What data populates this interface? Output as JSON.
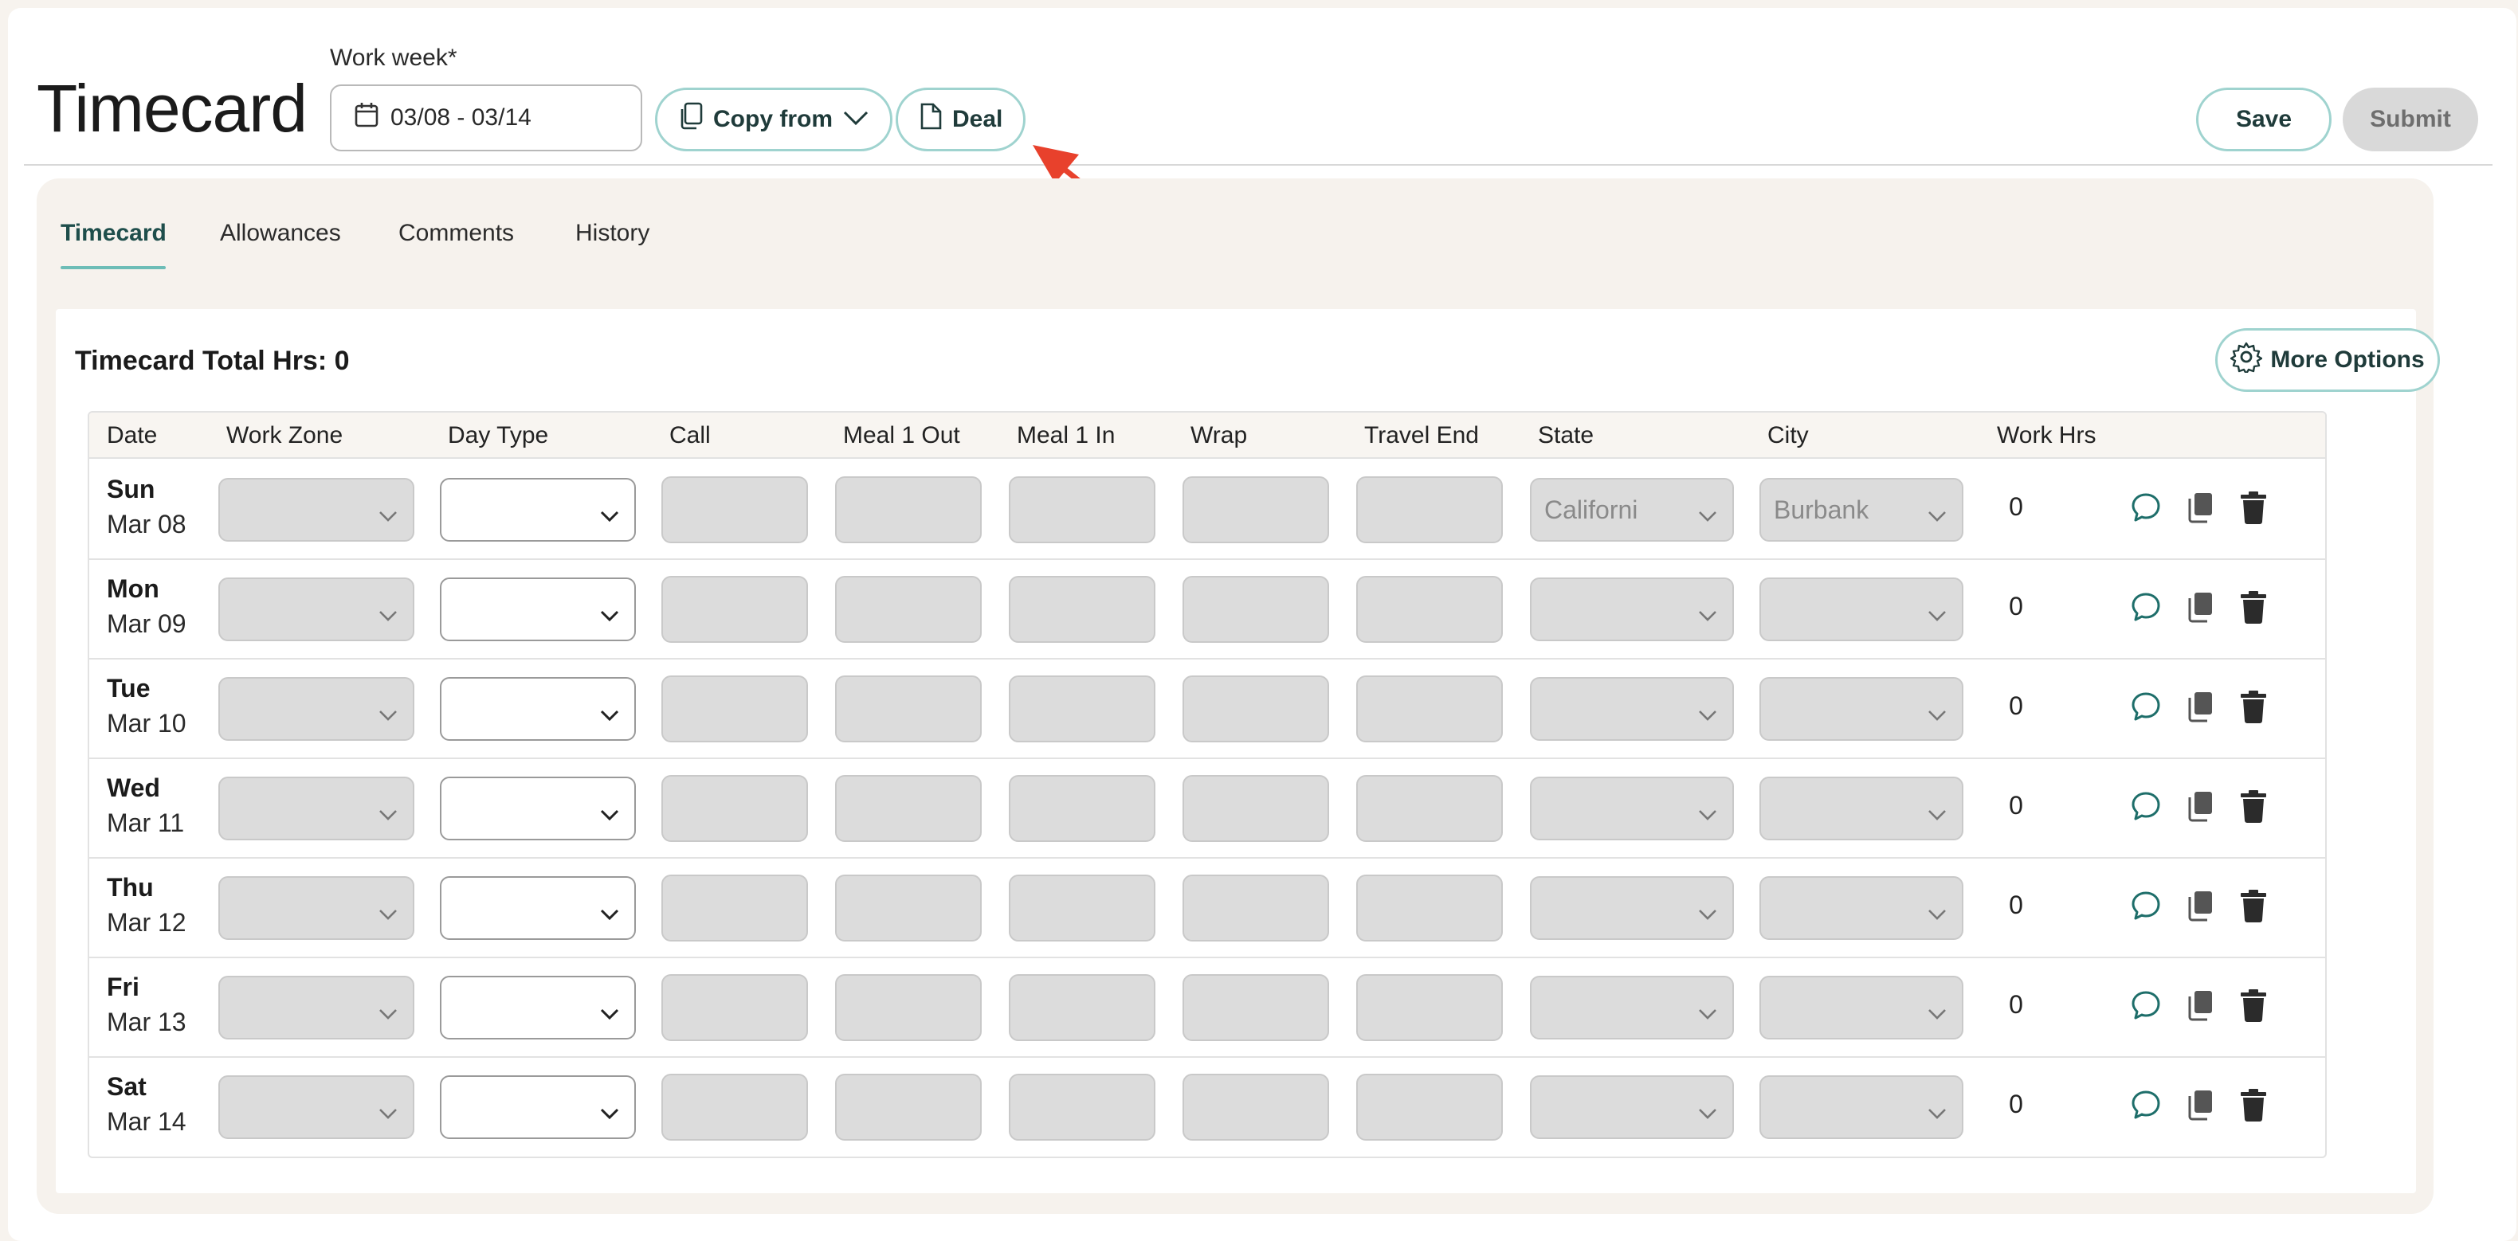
{
  "header": {
    "title": "Timecard",
    "work_week_label": "Work week*",
    "work_week_value": "03/08 - 03/14",
    "copy_from_label": "Copy from",
    "deal_label": "Deal",
    "save_label": "Save",
    "submit_label": "Submit"
  },
  "tabs": [
    {
      "label": "Timecard",
      "active": true
    },
    {
      "label": "Allowances",
      "active": false
    },
    {
      "label": "Comments",
      "active": false
    },
    {
      "label": "History",
      "active": false
    }
  ],
  "summary": {
    "total_label": "Timecard Total Hrs: 0",
    "more_options_label": "More Options"
  },
  "table": {
    "columns": [
      "Date",
      "Work Zone",
      "Day Type",
      "Call",
      "Meal 1 Out",
      "Meal 1 In",
      "Wrap",
      "Travel End",
      "State",
      "City",
      "Work Hrs"
    ],
    "rows": [
      {
        "day": "Sun",
        "date": "Mar 08",
        "state": "Californi",
        "city": "Burbank",
        "work_hrs": "0"
      },
      {
        "day": "Mon",
        "date": "Mar 09",
        "state": "",
        "city": "",
        "work_hrs": "0"
      },
      {
        "day": "Tue",
        "date": "Mar 10",
        "state": "",
        "city": "",
        "work_hrs": "0"
      },
      {
        "day": "Wed",
        "date": "Mar 11",
        "state": "",
        "city": "",
        "work_hrs": "0"
      },
      {
        "day": "Thu",
        "date": "Mar 12",
        "state": "",
        "city": "",
        "work_hrs": "0"
      },
      {
        "day": "Fri",
        "date": "Mar 13",
        "state": "",
        "city": "",
        "work_hrs": "0"
      },
      {
        "day": "Sat",
        "date": "Mar 14",
        "state": "",
        "city": "",
        "work_hrs": "0"
      }
    ]
  },
  "icons": {
    "calendar": "calendar-icon",
    "copy": "copy-icon",
    "document": "document-icon",
    "gear": "gear-icon",
    "comment": "comment-icon",
    "duplicate": "duplicate-icon",
    "trash": "trash-icon"
  },
  "colors": {
    "accent": "#6dbdb7",
    "accent_border": "#9fd3cf",
    "annotation_arrow": "#e8412c",
    "disabled_bg": "#dcdcdc"
  }
}
